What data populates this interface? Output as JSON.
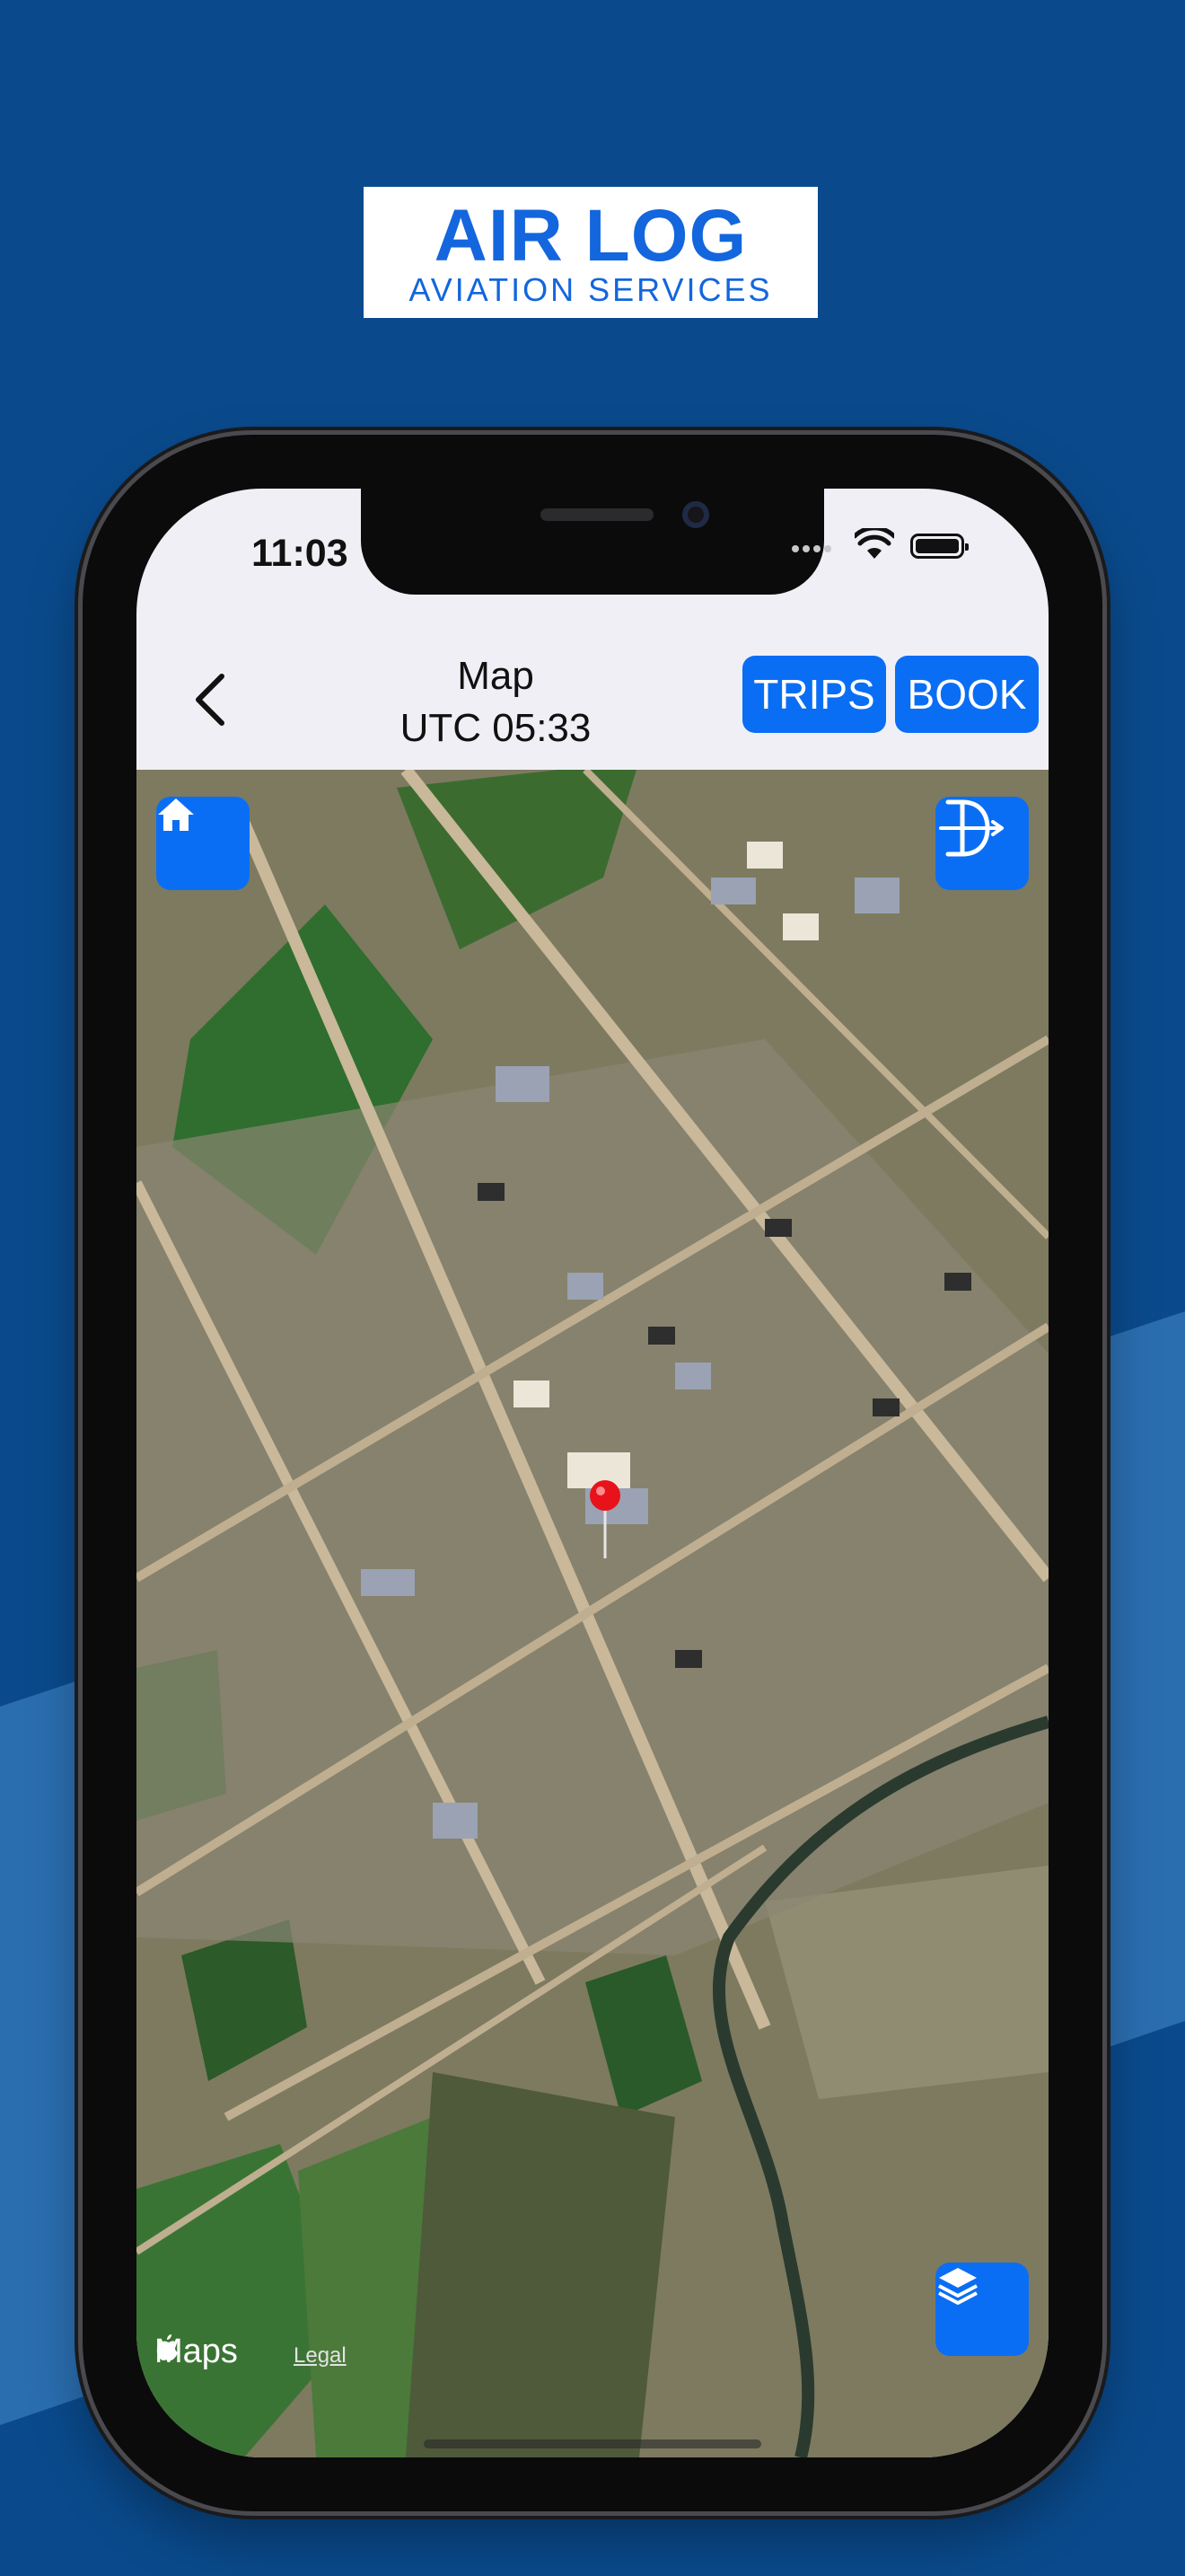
{
  "brand": {
    "logo_line1": "AIR LOG",
    "logo_line2": "AVIATION SERVICES",
    "color": "#1366dd"
  },
  "background": {
    "primary": "#0a4a8c",
    "secondary": "#2a6eb0"
  },
  "status_bar": {
    "time": "11:03",
    "icons": [
      "cellular-dots-icon",
      "wifi-icon",
      "battery-icon"
    ]
  },
  "nav": {
    "back_icon": "chevron-left-icon",
    "title": "Map",
    "subtitle": "UTC 05:33",
    "trips_label": "TRIPS",
    "book_label": "BOOK",
    "accent": "#0a6ef5"
  },
  "map": {
    "type": "satellite",
    "home_icon": "home-icon",
    "track_icon": "route-tracking-icon",
    "layers_icon": "layers-icon",
    "marker_icon": "red-pin-icon",
    "attribution": "Maps",
    "legal": "Legal"
  }
}
